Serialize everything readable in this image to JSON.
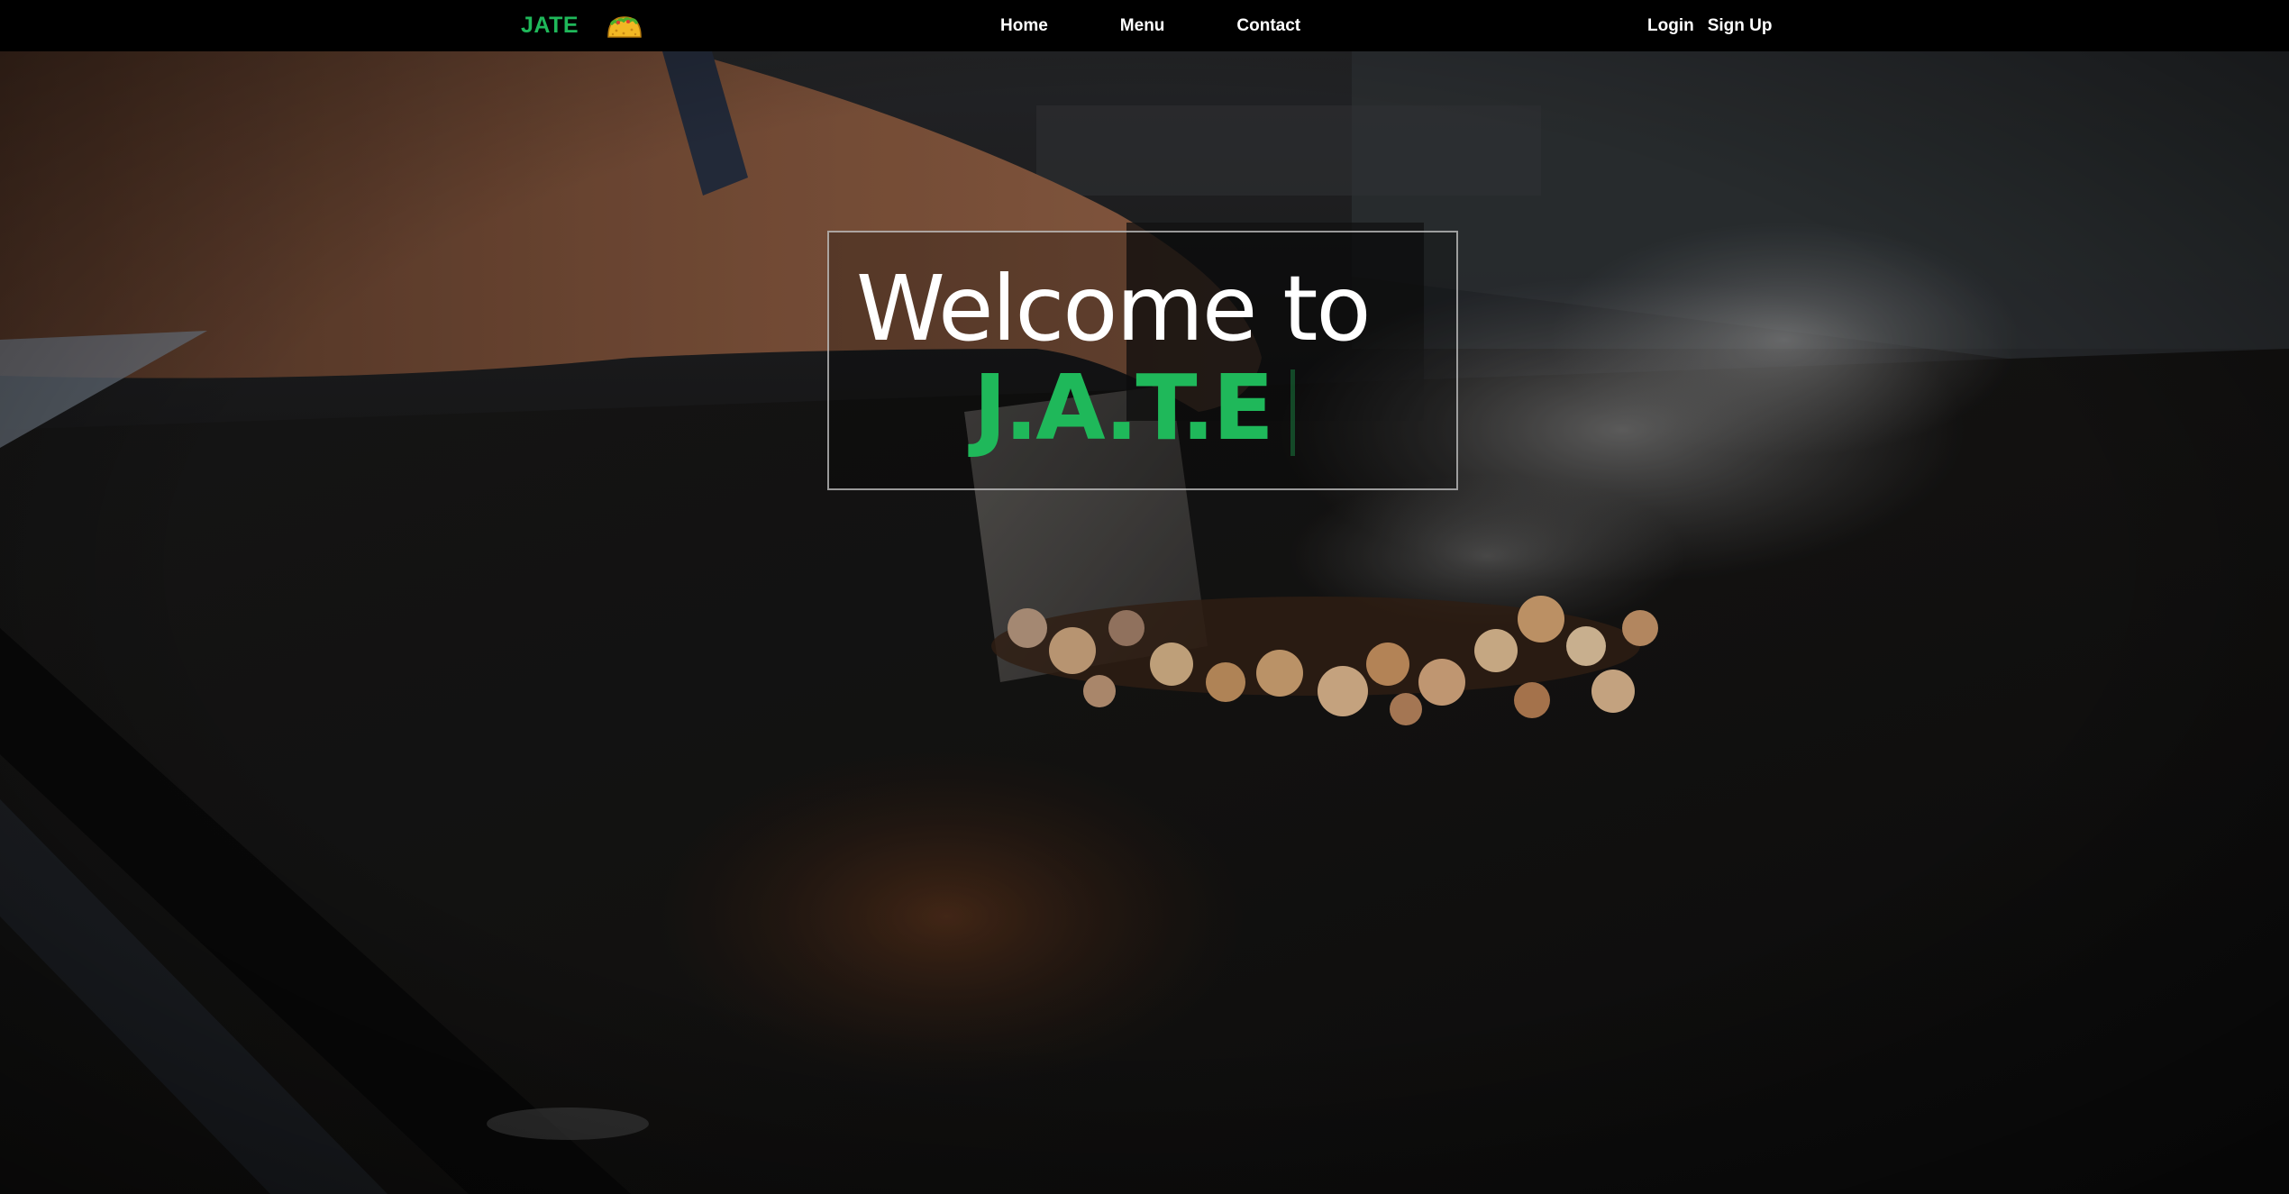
{
  "navbar": {
    "brand": "JATE",
    "brand_icon": "taco-icon",
    "links": [
      "Home",
      "Menu",
      "Contact"
    ],
    "auth": {
      "login": "Login",
      "signup": "Sign Up"
    }
  },
  "hero": {
    "welcome": "Welcome to",
    "title": "J.A.T.E",
    "background_description_icon": "griddle-cooking-image"
  },
  "colors": {
    "brand_green": "#1fb85a",
    "navbar_bg": "#000000",
    "text_white": "#ffffff"
  }
}
